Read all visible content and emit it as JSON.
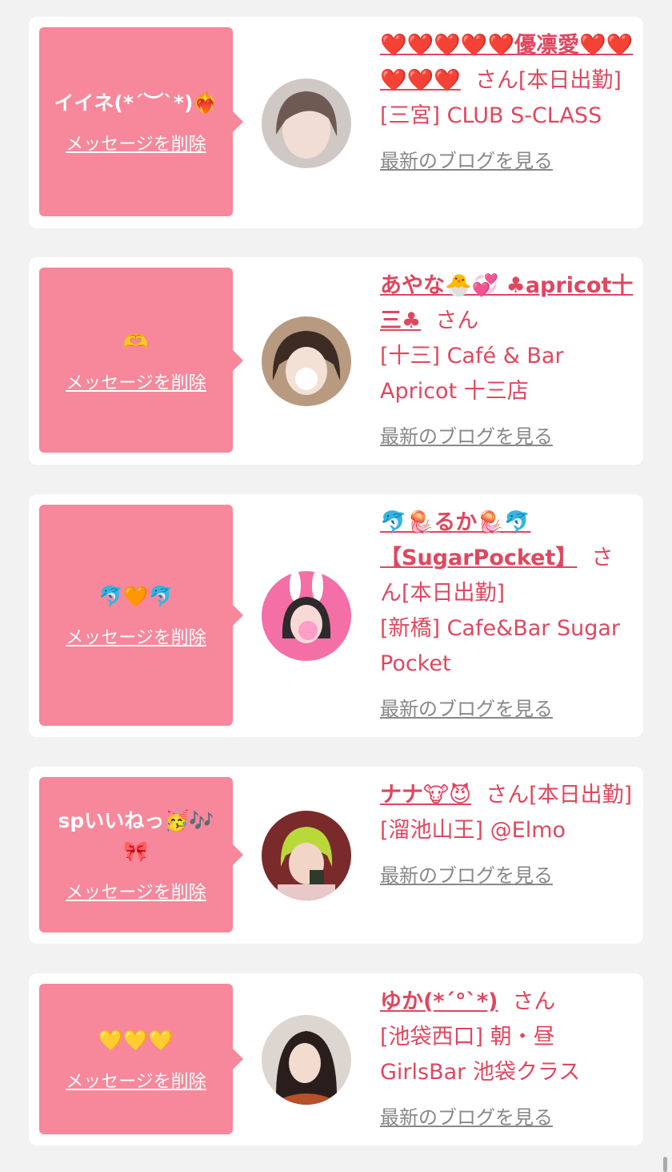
{
  "delete_label": "メッセージを削除",
  "blog_label": "最新のブログを見る",
  "san_label": "さん",
  "colors": {
    "accent": "#e0475f",
    "bubble": "#f7879a",
    "background": "#f2f2f2"
  },
  "items": [
    {
      "message": "イイネ(*´︶`*)❤️‍🔥",
      "name": "❤️❤️❤️❤️❤️優凛愛❤️❤️❤️❤️❤️",
      "status": "[本日出勤]",
      "shop": "[三宮] CLUB S-CLASS"
    },
    {
      "message": "🫶",
      "name": "あやな🐣💞 ♣apricot十三♣",
      "status": "",
      "shop": "[十三] Café & Bar Apricot 十三店"
    },
    {
      "message": "🐬🧡🐬",
      "name": "🐬🪼るか🪼🐬【SugarPocket】",
      "status": "[本日出勤]",
      "shop": "[新橋] Cafe&Bar Sugar Pocket"
    },
    {
      "message": "spいいねっ🥳🎶🎀",
      "name": "ナナ🐮😈",
      "status": "[本日出勤]",
      "shop": "[溜池山王] @Elmo"
    },
    {
      "message": "💛💛💛",
      "name": "ゆか(*´°`*)",
      "status": "",
      "shop": "[池袋西口] 朝・昼GirlsBar 池袋クラス"
    }
  ]
}
